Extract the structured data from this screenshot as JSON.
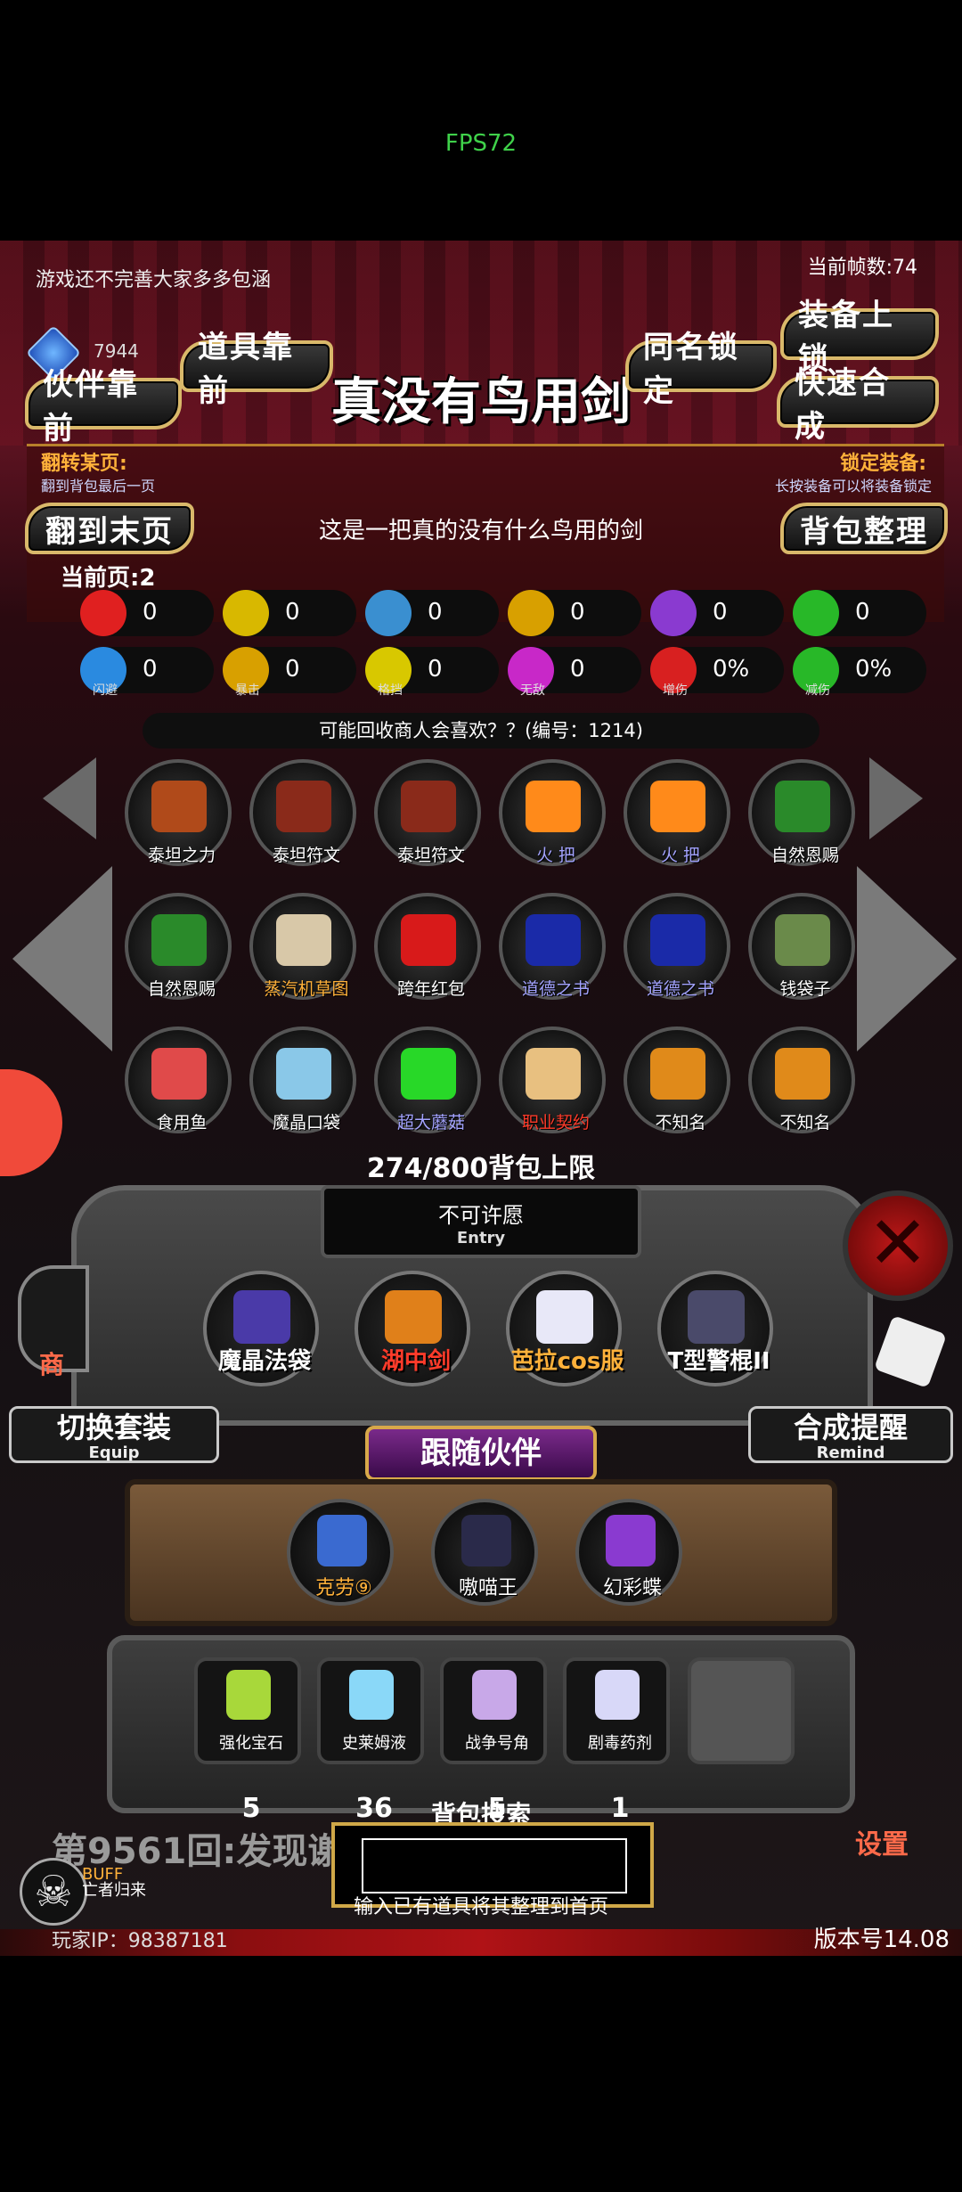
{
  "status": {
    "fps": "FPS72"
  },
  "header": {
    "notice": "游戏还不完善大家多多包涵",
    "current_fps": "当前帧数:74",
    "gem_count": "7944",
    "item_title": "真没有鸟用剑",
    "item_desc": "这是一把真的没有什么鸟用的剑",
    "current_page": "当前页:2",
    "recycle_text": "可能回收商人会喜欢？？(编号：1214)"
  },
  "buttons": {
    "partner_front": "伙伴靠前",
    "item_front": "道具靠前",
    "same_name_lock": "同名锁定",
    "equip_lock": "装备上锁",
    "quick_craft": "快速合成",
    "to_last_page": "翻到末页",
    "bag_sort": "背包整理"
  },
  "hints": {
    "flip_label": "翻转某页:",
    "flip_sub": "翻到背包最后一页",
    "lock_label": "锁定装备:",
    "lock_sub": "长按装备可以将装备锁定"
  },
  "stats": [
    {
      "icon": "heart-icon",
      "value": "0",
      "caption": "",
      "color": "#e02020"
    },
    {
      "icon": "armor-icon",
      "value": "0",
      "caption": "",
      "color": "#d8b800"
    },
    {
      "icon": "boot-icon",
      "value": "0",
      "caption": "",
      "color": "#3a8fd0"
    },
    {
      "icon": "sword-icon",
      "value": "0",
      "caption": "",
      "color": "#d8a000"
    },
    {
      "icon": "lightning-icon",
      "value": "0",
      "caption": "",
      "color": "#8a3ad0"
    },
    {
      "icon": "clover-icon",
      "value": "0",
      "caption": "",
      "color": "#28b828"
    },
    {
      "icon": "dodge-icon",
      "value": "0",
      "caption": "闪避",
      "color": "#2a8ae0"
    },
    {
      "icon": "crit-icon",
      "value": "0",
      "caption": "暴击",
      "color": "#d8a000"
    },
    {
      "icon": "block-icon",
      "value": "0",
      "caption": "格挡",
      "color": "#d8c800"
    },
    {
      "icon": "invincible-icon",
      "value": "0",
      "caption": "无敌",
      "color": "#c828c8"
    },
    {
      "icon": "dmg-up-icon",
      "value": "0%",
      "caption": "增伤",
      "color": "#d82020"
    },
    {
      "icon": "dmg-down-icon",
      "value": "0%",
      "caption": "减伤",
      "color": "#28b828"
    }
  ],
  "inventory": [
    {
      "name": "泰坦之力",
      "color": "#b04a1a",
      "text_color": "#ffffff"
    },
    {
      "name": "泰坦符文",
      "color": "#8a2a1a",
      "text_color": "#ffffff"
    },
    {
      "name": "泰坦符文",
      "color": "#8a2a1a",
      "text_color": "#ffffff"
    },
    {
      "name": "火 把",
      "color": "#ff8a1a",
      "text_color": "#a3a3ff"
    },
    {
      "name": "火 把",
      "color": "#ff8a1a",
      "text_color": "#a3a3ff"
    },
    {
      "name": "自然恩赐",
      "color": "#2a8a2a",
      "text_color": "#ffffff"
    },
    {
      "name": "自然恩赐",
      "color": "#2a8a2a",
      "text_color": "#ffffff"
    },
    {
      "name": "蒸汽机草图",
      "color": "#d8c8a8",
      "text_color": "#ffb13a"
    },
    {
      "name": "跨年红包",
      "color": "#d81a1a",
      "text_color": "#ffffff"
    },
    {
      "name": "道德之书",
      "color": "#1a2aa8",
      "text_color": "#a3a3ff"
    },
    {
      "name": "道德之书",
      "color": "#1a2aa8",
      "text_color": "#a3a3ff"
    },
    {
      "name": "钱袋子",
      "color": "#6a8a4a",
      "text_color": "#ffffff"
    },
    {
      "name": "食用鱼",
      "color": "#e04a4a",
      "text_color": "#ffffff"
    },
    {
      "name": "魔晶口袋",
      "color": "#8ac8e8",
      "text_color": "#ffffff"
    },
    {
      "name": "超大蘑菇",
      "color": "#28d828",
      "text_color": "#a3a3ff"
    },
    {
      "name": "职业契约",
      "color": "#e8c080",
      "text_color": "#ff3b2a"
    },
    {
      "name": "不知名",
      "color": "#e08a1a",
      "text_color": "#ffffff"
    },
    {
      "name": "不知名",
      "color": "#e08a1a",
      "text_color": "#ffffff"
    }
  ],
  "bag_limit": "274/800背包上限",
  "entry": {
    "text": "不可许愿",
    "label": "Entry"
  },
  "equipped": [
    {
      "name": "魔晶法袋",
      "color": "#4a3aa8",
      "text_color": "#ffffff"
    },
    {
      "name": "湖中剑",
      "color": "#e0801a",
      "text_color": "#ff3b2a"
    },
    {
      "name": "芭拉cos服",
      "color": "#e8e8f8",
      "text_color": "#ffb13a"
    },
    {
      "name": "T型警棍II",
      "color": "#4a4a6a",
      "text_color": "#ffffff"
    }
  ],
  "side_buttons": {
    "switch_set": "切换套装",
    "switch_set_sub": "Equip",
    "craft_remind": "合成提醒",
    "craft_remind_sub": "Remind",
    "shop": "商",
    "settings": "设置"
  },
  "follow": {
    "title": "跟随伙伴",
    "partners": [
      {
        "name": "克劳⑨",
        "color": "#3a6ad0",
        "text_color": "#ffb13a"
      },
      {
        "name": "嗷喵王",
        "color": "#2a2a4a",
        "text_color": "#ffffff"
      },
      {
        "name": "幻彩蝶",
        "color": "#8a3ad0",
        "text_color": "#ffffff"
      }
    ]
  },
  "consumables": [
    {
      "name": "强化宝石",
      "qty": "5",
      "color": "#a8d83a"
    },
    {
      "name": "史莱姆液",
      "qty": "36",
      "color": "#8ad8f8"
    },
    {
      "name": "战争号角",
      "qty": "5",
      "color": "#c8a8e8"
    },
    {
      "name": "剧毒药剂",
      "qty": "1",
      "color": "#d8d8f8"
    }
  ],
  "search": {
    "title": "背包搜索",
    "value": "",
    "hint": "输入已有道具将其整理到首页"
  },
  "footer": {
    "round_log": "第9561回:发现谢",
    "buff_label": "BUFF",
    "buff_sub": "亡者归来",
    "player_ip": "玩家IP：98387181",
    "version": "版本号14.08"
  }
}
